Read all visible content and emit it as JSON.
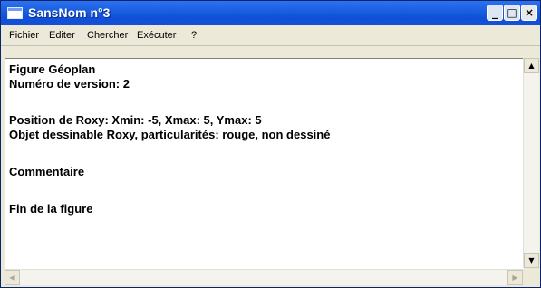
{
  "window": {
    "title": "SansNom n°3",
    "buttons": {
      "minimize": "_",
      "maximize": "□",
      "close": "×"
    }
  },
  "menu": {
    "items": [
      "Fichier",
      "Editer",
      "Chercher",
      "Exécuter",
      "?"
    ]
  },
  "editor": {
    "lines": [
      "Figure Géoplan",
      "Numéro de version: 2",
      "",
      "Position de Roxy: Xmin: -5, Xmax: 5, Ymax: 5",
      "Objet dessinable Roxy, particularités: rouge, non dessiné",
      "",
      "Commentaire",
      "",
      "Fin de la figure"
    ]
  },
  "scrollbars": {
    "up_arrow": "▲",
    "down_arrow": "▼",
    "left_arrow": "◀",
    "right_arrow": "▶"
  },
  "icons": {
    "window_icon": "window-icon",
    "colors": {
      "titlebar": "#1a5fe0",
      "title_text": "#ffffff"
    }
  }
}
